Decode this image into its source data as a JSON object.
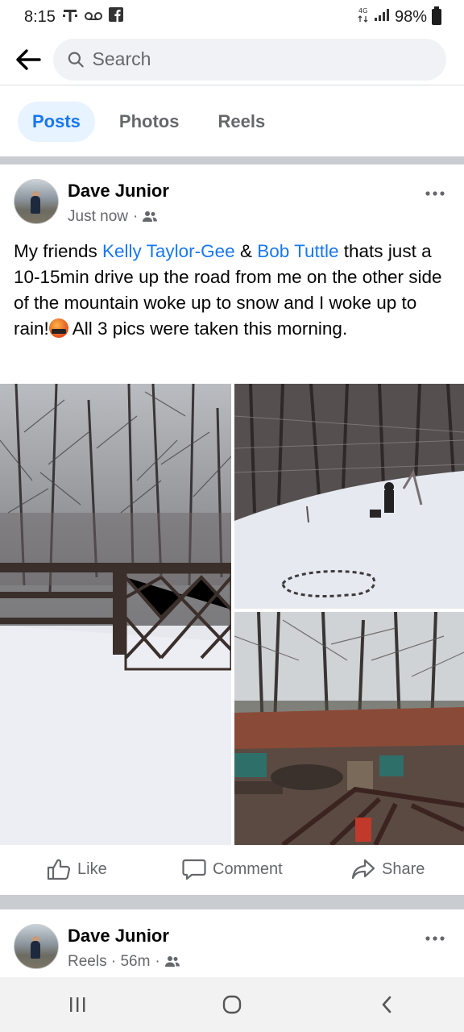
{
  "status_bar": {
    "time": "8:15",
    "carrier_icon": "t-mobile-icon",
    "voicemail_icon": "voicemail-icon",
    "facebook_icon": "facebook-icon",
    "battery": "98%"
  },
  "header": {
    "search_placeholder": "Search"
  },
  "tabs": [
    {
      "label": "Posts",
      "active": true
    },
    {
      "label": "Photos",
      "active": false
    },
    {
      "label": "Reels",
      "active": false
    }
  ],
  "post": {
    "author": "Dave Junior",
    "time": "Just now",
    "text_parts": {
      "p1": "My friends ",
      "mention1": "Kelly Taylor-Gee",
      "p2": " & ",
      "mention2": "Bob Tuttle",
      "p3": " thats just a 10-15min drive up the road from me on the other side of the mountain woke up to snow and I woke up to rain!",
      "p4": " All 3 pics were taken this morning."
    },
    "actions": {
      "like": "Like",
      "comment": "Comment",
      "share": "Share"
    }
  },
  "next_post": {
    "author": "Dave Junior",
    "meta": "Reels · 56m"
  },
  "colors": {
    "accent": "#1877f2",
    "secondary_text": "#65676b",
    "divider": "#c9ccd1"
  }
}
